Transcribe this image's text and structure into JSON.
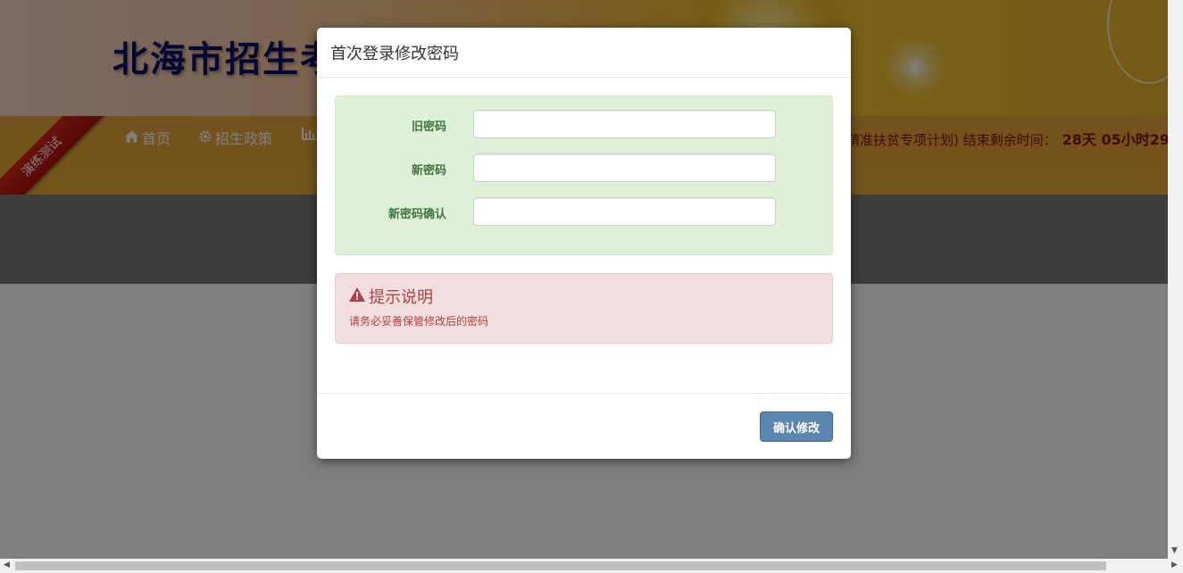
{
  "site": {
    "title": "北海市招生考"
  },
  "nav": {
    "items": [
      {
        "icon": "home-icon",
        "label": "首页"
      },
      {
        "icon": "gear-icon",
        "label": "招生政策"
      },
      {
        "icon": "bar-chart-icon",
        "label": ""
      }
    ],
    "countdown_text": "精准扶贫专项计划) 结束剩余时间：",
    "countdown_value": "28天 05小时29"
  },
  "ribbon": {
    "label": "演练测试"
  },
  "modal": {
    "title": "首次登录修改密码",
    "fields": [
      {
        "label": "旧密码",
        "value": "",
        "placeholder": ""
      },
      {
        "label": "新密码",
        "value": "",
        "placeholder": ""
      },
      {
        "label": "新密码确认",
        "value": "",
        "placeholder": ""
      }
    ],
    "alert": {
      "icon": "warning-icon",
      "title": "提示说明",
      "text": "请务必妥善保管修改后的密码"
    },
    "confirm_label": "确认修改"
  },
  "colors": {
    "form_panel_bg": "#dff0d8",
    "form_label": "#3c763d",
    "alert_bg": "#f2dede",
    "alert_text": "#a94442",
    "confirm_button": "#5c85b0",
    "nav_bg": "#e8a53a",
    "countdown_text": "#7c1711"
  }
}
